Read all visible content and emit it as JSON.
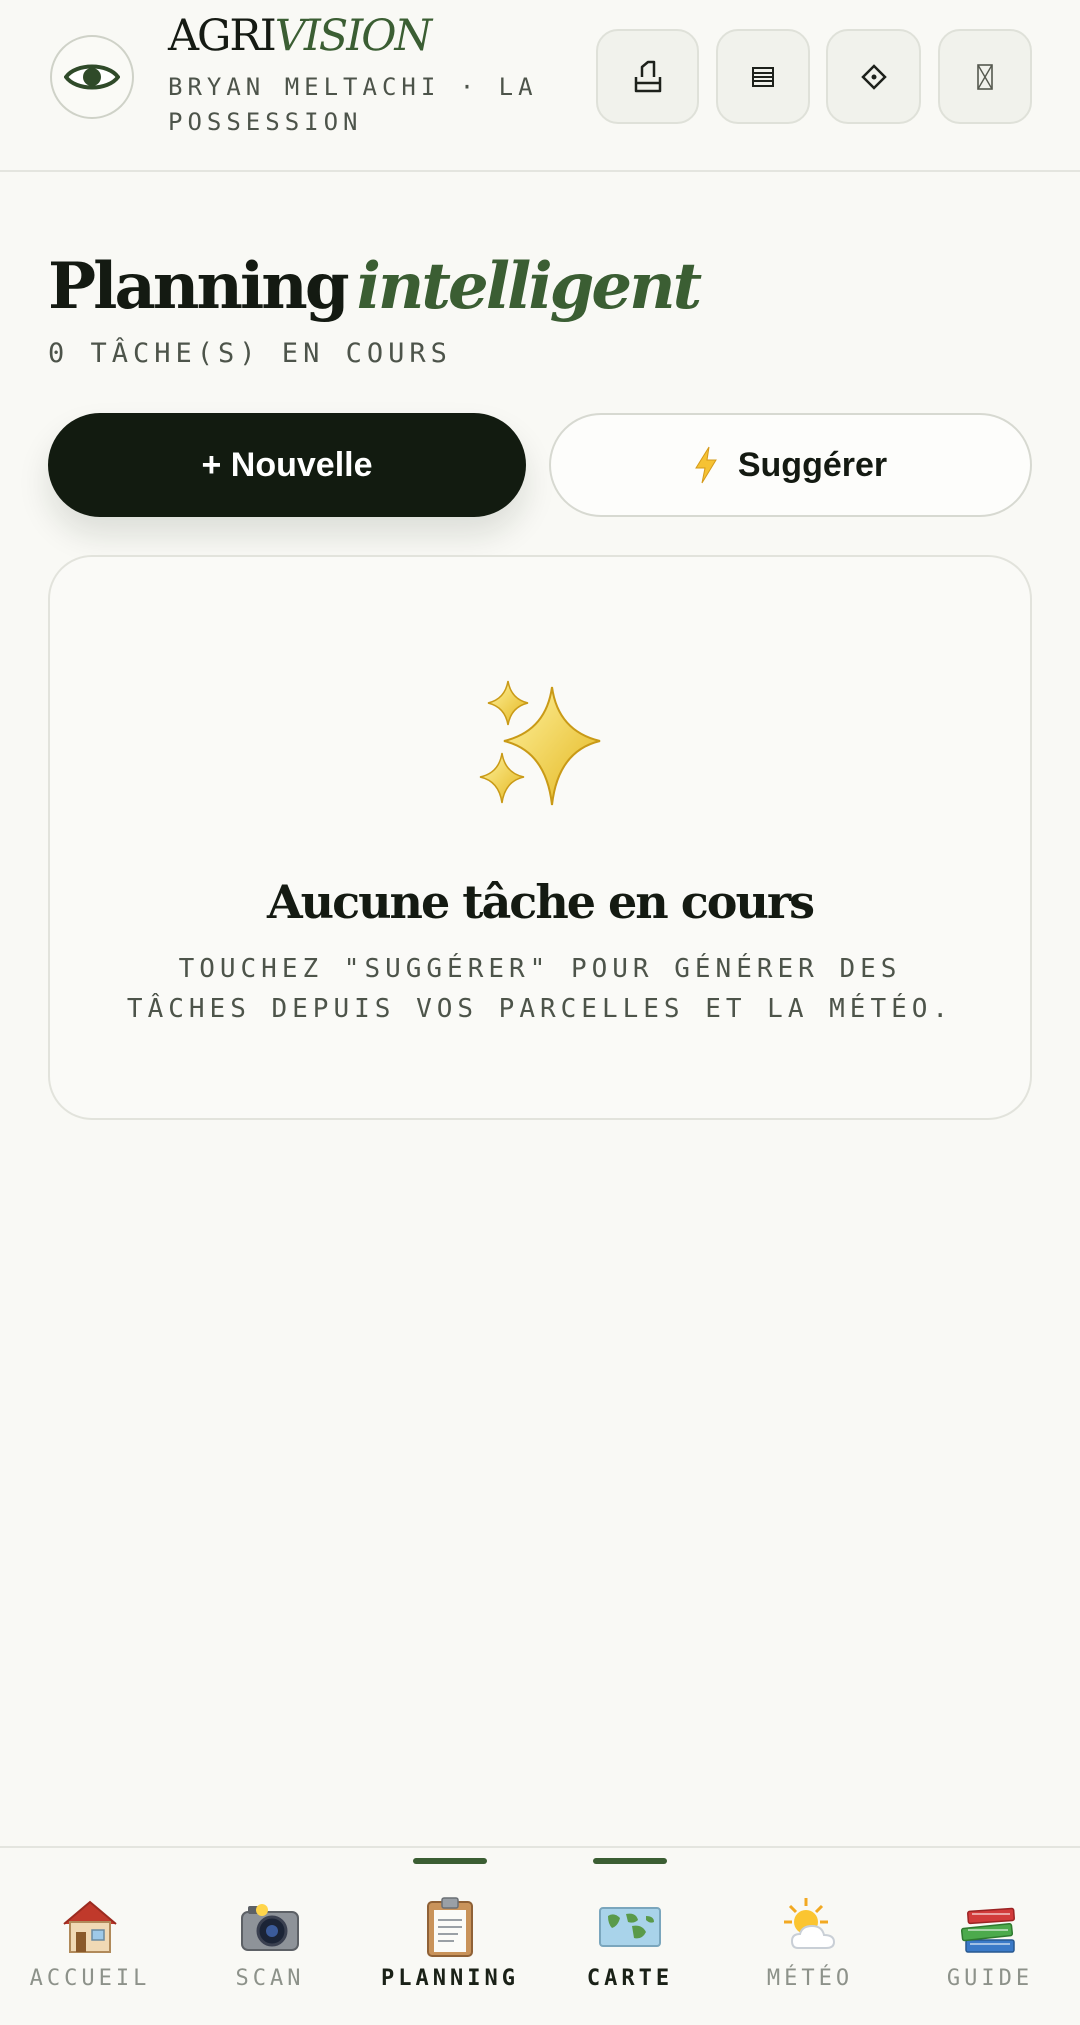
{
  "header": {
    "brand_part1": "AGRI",
    "brand_part2": "VISION",
    "subtitle": "BRYAN MELTACHI · LA POSSESSION",
    "actions": [
      {
        "icon": "export-icon"
      },
      {
        "icon": "list-icon"
      },
      {
        "icon": "diamond-icon"
      },
      {
        "icon": "placeholder-glyph-icon"
      }
    ]
  },
  "page": {
    "title_part1": "Planning",
    "title_part2": "intelligent",
    "task_count": "0 TÂCHE(S) EN COURS"
  },
  "buttons": {
    "new_label": "+ Nouvelle",
    "suggest_label": "Suggérer"
  },
  "empty_state": {
    "icon": "sparkles-icon",
    "title": "Aucune tâche en cours",
    "description": "TOUCHEZ \"SUGGÉRER\" POUR GÉNÉRER DES TÂCHES DEPUIS VOS PARCELLES ET LA MÉTÉO."
  },
  "nav": {
    "items": [
      {
        "label": "ACCUEIL",
        "icon": "house-icon"
      },
      {
        "label": "SCAN",
        "icon": "camera-icon"
      },
      {
        "label": "PLANNING",
        "icon": "clipboard-icon",
        "active": true
      },
      {
        "label": "CARTE",
        "icon": "map-icon",
        "active": true
      },
      {
        "label": "MÉTÉO",
        "icon": "weather-icon"
      },
      {
        "label": "GUIDE",
        "icon": "books-icon"
      }
    ]
  },
  "colors": {
    "accent": "#3b5e33",
    "primary_dark": "#121b10",
    "background": "#f9f9f5"
  }
}
